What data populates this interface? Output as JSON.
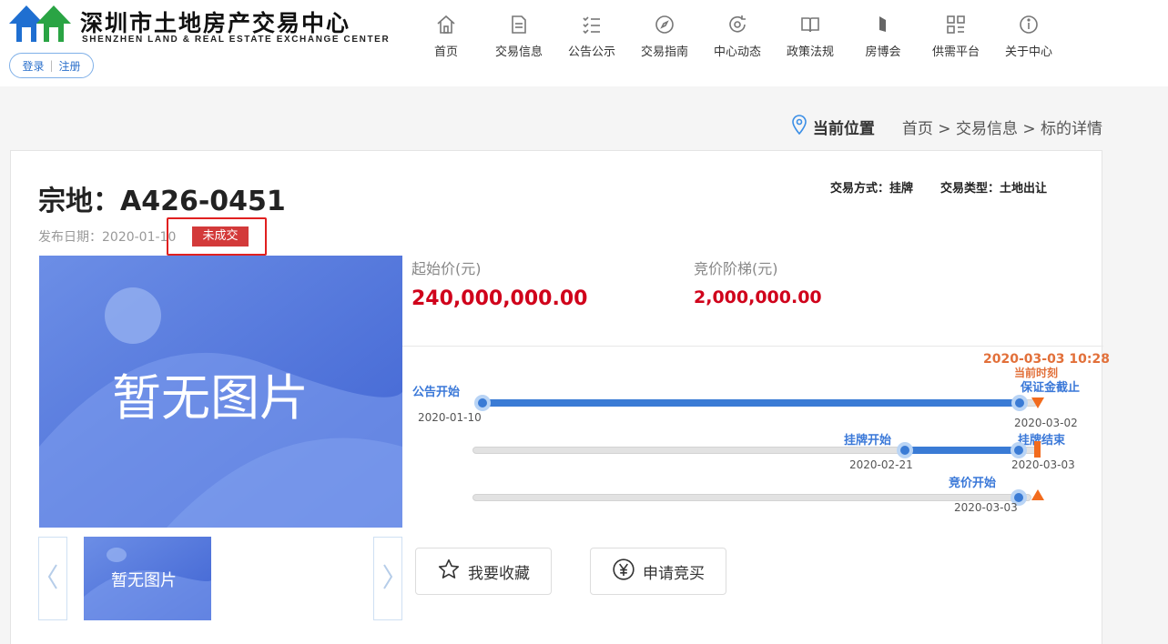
{
  "header": {
    "logo_cn": "深圳市土地房产交易中心",
    "logo_en": "SHENZHEN LAND & REAL ESTATE EXCHANGE CENTER",
    "brand_colors": {
      "blue": "#1f6fd1",
      "green": "#2aa444"
    },
    "auth": {
      "login": "登录",
      "register": "注册",
      "separator": "|"
    },
    "nav": [
      {
        "label": "首页",
        "icon": "home-icon"
      },
      {
        "label": "交易信息",
        "icon": "document-icon"
      },
      {
        "label": "公告公示",
        "icon": "checklist-icon"
      },
      {
        "label": "交易指南",
        "icon": "compass-icon"
      },
      {
        "label": "中心动态",
        "icon": "refresh-icon"
      },
      {
        "label": "政策法规",
        "icon": "book-icon"
      },
      {
        "label": "房博会",
        "icon": "flag-icon"
      },
      {
        "label": "供需平台",
        "icon": "grid-icon"
      },
      {
        "label": "关于中心",
        "icon": "info-icon"
      }
    ]
  },
  "breadcrumb": {
    "title": "当前位置",
    "path": "首页 > 交易信息 > 标的详情"
  },
  "detail": {
    "title": "宗地：A426-0451",
    "trade_mode_label": "交易方式：",
    "trade_mode": "挂牌",
    "trade_type_label": "交易类型：",
    "trade_type": "土地出让",
    "publish_date": "发布日期：2020-01-10",
    "status": "未成交",
    "image_placeholder": "暂无图片",
    "thumb_placeholder": "暂无图片",
    "start_price_label": "起始价(元)",
    "start_price": "240,000,000.00",
    "increment_label": "竞价阶梯(元)",
    "increment": "2,000,000.00",
    "accent_red": "#d0021b"
  },
  "timeline": {
    "current_time": "2020-03-03 10:28",
    "current_label": "当前时刻",
    "rows": [
      {
        "start_label": "公告开始",
        "start_date": "2020-01-10",
        "end_label": "保证金截止",
        "end_date": "2020-03-02",
        "progress": 1.0
      },
      {
        "start_label": "挂牌开始",
        "start_date": "2020-02-21",
        "end_label": "挂牌结束",
        "end_date": "2020-03-03",
        "progress": 1.0
      },
      {
        "start_label": "竞价开始",
        "start_date": "2020-03-03",
        "progress": 0.0
      }
    ],
    "colors": {
      "progress": "#3a7bd5",
      "current": "#f26b1d"
    }
  },
  "actions": {
    "favorite": "我要收藏",
    "bid": "申请竞买"
  }
}
